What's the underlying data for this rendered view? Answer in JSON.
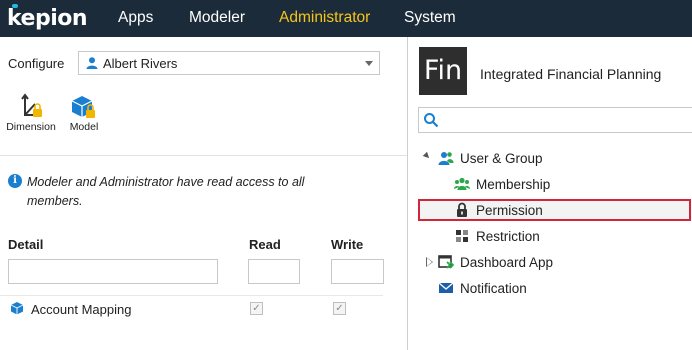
{
  "nav": {
    "logo": "kepion",
    "items": [
      {
        "label": "Apps",
        "active": false
      },
      {
        "label": "Modeler",
        "active": false
      },
      {
        "label": "Administrator",
        "active": true
      },
      {
        "label": "System",
        "active": false
      }
    ],
    "active_color": "#f5c518",
    "bar_color": "#1c2b39"
  },
  "configure": {
    "label": "Configure",
    "selected_user": "Albert Rivers"
  },
  "toolbar": {
    "dimension_label": "Dimension",
    "model_label": "Model"
  },
  "info": {
    "text": "Modeler and Administrator have read access to all members."
  },
  "table": {
    "headers": {
      "detail": "Detail",
      "read": "Read",
      "write": "Write"
    },
    "rows": [
      {
        "label": "Account Mapping",
        "read": true,
        "write": true
      }
    ]
  },
  "app": {
    "badge": "Fin",
    "title": "Integrated Financial Planning"
  },
  "tree": {
    "user_group": "User & Group",
    "membership": "Membership",
    "permission": "Permission",
    "restriction": "Restriction",
    "dashboard_app": "Dashboard App",
    "notification": "Notification",
    "selected": "Permission",
    "highlight_color": "#d0263a"
  }
}
